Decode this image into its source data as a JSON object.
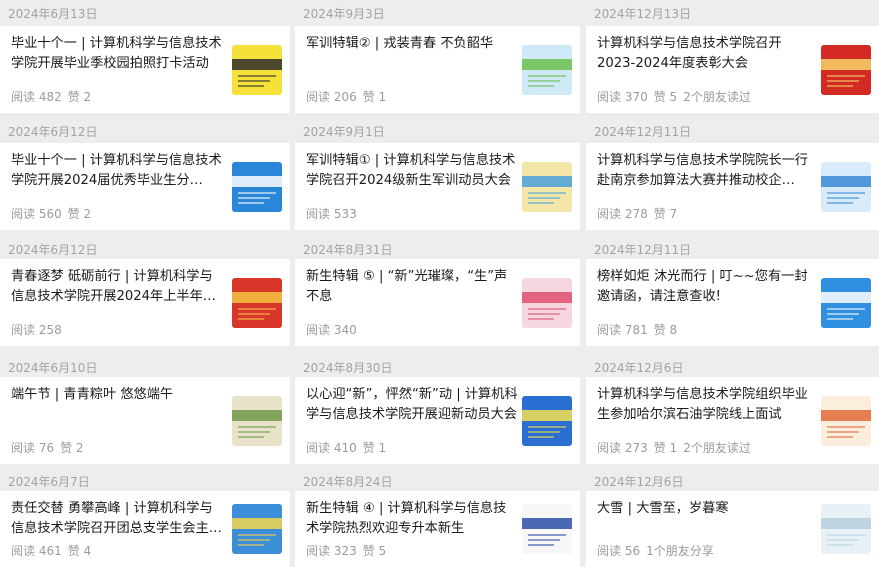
{
  "columns": [
    {
      "items": [
        {
          "date": "2024年6月13日",
          "title": "毕业十个一 | 计算机科学与信息技术学院开展毕业季校园拍照打卡活动",
          "reads": "阅读 482",
          "likes": "赞 2",
          "friends": "",
          "thumb_icon": "graduation-banner-thumbnail",
          "thumb_colors": [
            "#f5e13a",
            "#2d2d2d"
          ]
        },
        {
          "date": "2024年6月12日",
          "title": "毕业十个一 | 计算机科学与信息技术学院开展2024届优秀毕业生分…",
          "reads": "阅读 560",
          "likes": "赞 2",
          "friends": "",
          "thumb_icon": "graduation-blue-thumbnail",
          "thumb_colors": [
            "#2a86d9",
            "#ffffff"
          ]
        },
        {
          "date": "2024年6月12日",
          "title": "青春逐梦 砥砺前行 | 计算机科学与信息技术学院开展2024年上半年…",
          "reads": "阅读 258",
          "likes": "",
          "friends": "",
          "thumb_icon": "red-banner-thumbnail",
          "thumb_colors": [
            "#d9362b",
            "#f4c542"
          ]
        },
        {
          "date": "2024年6月10日",
          "title": "端午节 | 青青粽叶 悠悠端午",
          "reads": "阅读 76",
          "likes": "赞 2",
          "friends": "",
          "thumb_icon": "dragon-boat-thumbnail",
          "thumb_colors": [
            "#e8e2c9",
            "#6f9a4a"
          ]
        },
        {
          "date": "2024年6月7日",
          "title": "责任交替 勇攀高峰 | 计算机科学与信息技术学院召开团总支学生会主…",
          "reads": "阅读 461",
          "likes": "赞 4",
          "friends": "",
          "thumb_icon": "blue-banner-thumbnail",
          "thumb_colors": [
            "#3d8ed9",
            "#f2d64b"
          ]
        }
      ]
    },
    {
      "items": [
        {
          "date": "2024年9月3日",
          "title": "军训特辑② | 戎装青春 不负韶华",
          "reads": "阅读 206",
          "likes": "赞 1",
          "friends": "",
          "thumb_icon": "military-training-thumbnail",
          "thumb_colors": [
            "#cfe9f7",
            "#6cbf4f"
          ]
        },
        {
          "date": "2024年9月1日",
          "title": "军训特辑① | 计算机科学与信息技术学院召开2024级新生军训动员大会",
          "reads": "阅读 533",
          "likes": "",
          "friends": "",
          "thumb_icon": "military-training-thumbnail",
          "thumb_colors": [
            "#f2e7a6",
            "#4aa0d9"
          ]
        },
        {
          "date": "2024年8月31日",
          "title": "新生特辑 ⑤ | “新”光璀璨，“生”声不息",
          "reads": "阅读 340",
          "likes": "",
          "friends": "",
          "thumb_icon": "freshman-thumbnail",
          "thumb_colors": [
            "#f7d7df",
            "#e04f6f"
          ]
        },
        {
          "date": "2024年8月30日",
          "title": "以心迎“新”，怦然“新”动 | 计算机科学与信息技术学院开展迎新动员大会",
          "reads": "阅读 410",
          "likes": "赞 1",
          "friends": "",
          "thumb_icon": "freshman-blue-thumbnail",
          "thumb_colors": [
            "#2a6fd1",
            "#f4e04d"
          ]
        },
        {
          "date": "2024年8月24日",
          "title": "新生特辑 ④ | 计算机科学与信息技术学院热烈欢迎专升本新生",
          "reads": "阅读 323",
          "likes": "赞 5",
          "friends": "",
          "thumb_icon": "freshman-white-thumbnail",
          "thumb_colors": [
            "#f7f7f7",
            "#2b4fa8"
          ]
        }
      ]
    },
    {
      "items": [
        {
          "date": "2024年12月13日",
          "title": "计算机科学与信息技术学院召开2023-2024年度表彰大会",
          "reads": "阅读 370",
          "likes": "赞 5",
          "friends": "2个朋友读过",
          "thumb_icon": "award-red-thumbnail",
          "thumb_colors": [
            "#d32a23",
            "#f6d36a"
          ]
        },
        {
          "date": "2024年12月11日",
          "title": "计算机科学与信息技术学院院长一行赴南京参加算法大赛并推动校企…",
          "reads": "阅读 278",
          "likes": "赞 7",
          "friends": "",
          "thumb_icon": "contest-blue-thumbnail",
          "thumb_colors": [
            "#d7ebfa",
            "#3b8ad6"
          ]
        },
        {
          "date": "2024年12月11日",
          "title": "榜样如炬 沐光而行 | 叮~~您有一封邀请函，请注意查收!",
          "reads": "阅读 781",
          "likes": "赞 8",
          "friends": "",
          "thumb_icon": "invitation-blue-thumbnail",
          "thumb_colors": [
            "#2f8fe0",
            "#ffffff"
          ]
        },
        {
          "date": "2024年12月6日",
          "title": "计算机科学与信息技术学院组织毕业生参加哈尔滨石油学院线上面试",
          "reads": "阅读 273",
          "likes": "赞 1",
          "friends": "2个朋友读过",
          "thumb_icon": "interview-thumbnail",
          "thumb_colors": [
            "#fbeedc",
            "#e26a3a"
          ]
        },
        {
          "date": "2024年12月6日",
          "title": "大雪 | 大雪至，岁暮寒",
          "reads": "阅读 56",
          "likes": "",
          "friends": "1个朋友分享",
          "thumb_icon": "snow-thumbnail",
          "thumb_colors": [
            "#e8f1f6",
            "#b6cfdc"
          ]
        }
      ]
    }
  ]
}
